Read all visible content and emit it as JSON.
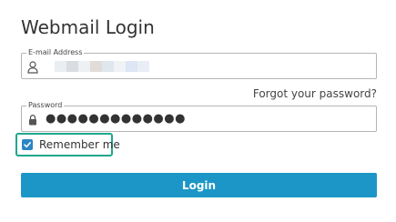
{
  "page": {
    "title": "Webmail Login"
  },
  "email": {
    "label": "E-mail Address",
    "icon": "user-icon",
    "value_obscured": true,
    "blur_colors": [
      "#e9eef3",
      "#d9dde2",
      "#eef0f2",
      "#e2dcd8",
      "#dfe6ee",
      "#f0f3f6",
      "#dce6f4",
      "#e9eef6"
    ]
  },
  "forgot": {
    "label": "Forgot your password?"
  },
  "password": {
    "label": "Password",
    "icon": "lock-icon",
    "masked_value": "●●●●●●●●●●●●●"
  },
  "remember": {
    "label": "Remember me",
    "checked": true,
    "highlight_color": "#1ea88c"
  },
  "login": {
    "label": "Login",
    "color": "#1b96c7"
  },
  "colors": {
    "text": "#333333",
    "border": "#b5b5b5",
    "checkbox": "#2a86c4"
  }
}
